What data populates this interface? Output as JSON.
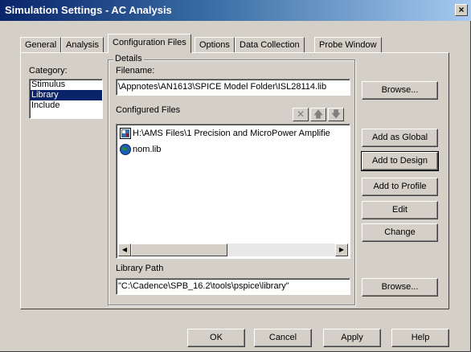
{
  "window": {
    "title": "Simulation Settings - AC Analysis",
    "close_glyph": "×"
  },
  "tabs": [
    {
      "label": "General"
    },
    {
      "label": "Analysis"
    },
    {
      "label": "Configuration Files",
      "active": true
    },
    {
      "label": "Options"
    },
    {
      "label": "Data Collection"
    },
    {
      "label": "Probe Window"
    }
  ],
  "category": {
    "label": "Category:",
    "items": [
      {
        "label": "Stimulus"
      },
      {
        "label": "Library",
        "selected": true
      },
      {
        "label": "Include"
      }
    ]
  },
  "details": {
    "title": "Details",
    "filename_label": "Filename:",
    "filename_value": "\\Appnotes\\AN1613\\SPICE Model Folder\\ISL28114.lib",
    "configured_files_label": "Configured Files",
    "toolbar": {
      "delete_glyph": "✕",
      "up_glyph": "🡅",
      "down_glyph": "🡇"
    },
    "files": [
      {
        "label": "H:\\AMS Files\\1 Precision and MicroPower Amplifie",
        "icon": "library-file-icon"
      },
      {
        "label": "nom.lib",
        "icon": "globe-icon"
      }
    ],
    "scroll": {
      "left_glyph": "◀",
      "right_glyph": "▶"
    },
    "library_path_label": "Library Path",
    "library_path_value": "\"C:\\Cadence\\SPB_16.2\\tools\\pspice\\library\""
  },
  "side_buttons": {
    "browse": "Browse...",
    "add_global": "Add as Global",
    "add_design": "Add to Design",
    "add_profile": "Add to Profile",
    "edit": "Edit",
    "change": "Change",
    "browse2": "Browse..."
  },
  "footer": {
    "ok": "OK",
    "cancel": "Cancel",
    "apply": "Apply",
    "help": "Help"
  }
}
